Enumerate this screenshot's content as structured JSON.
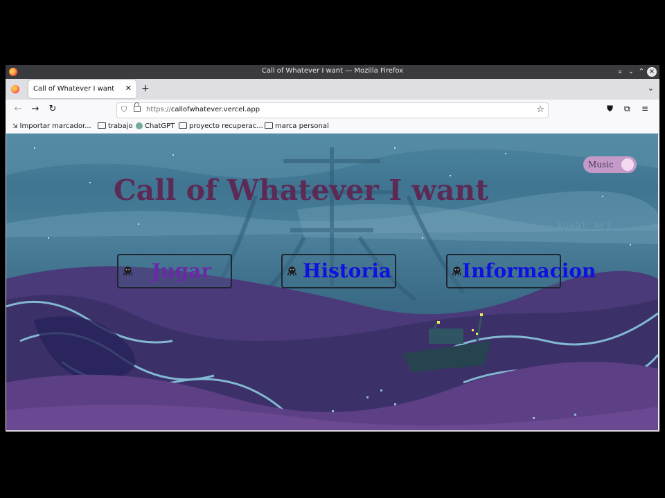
{
  "browser": {
    "window_title": "Call of Whatever I want — Mozilla Firefox",
    "tab_title": "Call of Whatever I want",
    "url_scheme": "https://",
    "url_host": "callofwhatever.vercel.app",
    "bookmarks": [
      {
        "label": "Importar marcador...",
        "icon": "import-icon"
      },
      {
        "label": "trabajo",
        "icon": "folder-icon"
      },
      {
        "label": "ChatGPT",
        "icon": "chatgpt-icon"
      },
      {
        "label": "proyecto recuperac...",
        "icon": "folder-icon"
      },
      {
        "label": "marca personal",
        "icon": "folder-icon"
      }
    ]
  },
  "page": {
    "title": "Call of Whatever I want",
    "music_label": "Music",
    "watermark": "kowal art",
    "menu": [
      {
        "label": "Jugar",
        "color": "#6a2aa8"
      },
      {
        "label": "Historia",
        "color": "#1010e0"
      },
      {
        "label": "Informacion",
        "color": "#1010e0"
      }
    ]
  },
  "colors": {
    "title_color": "#5c2a55",
    "toggle_bg": "#c49bc8",
    "sky": "#4e86a1",
    "waves": "#4a3a7a"
  }
}
